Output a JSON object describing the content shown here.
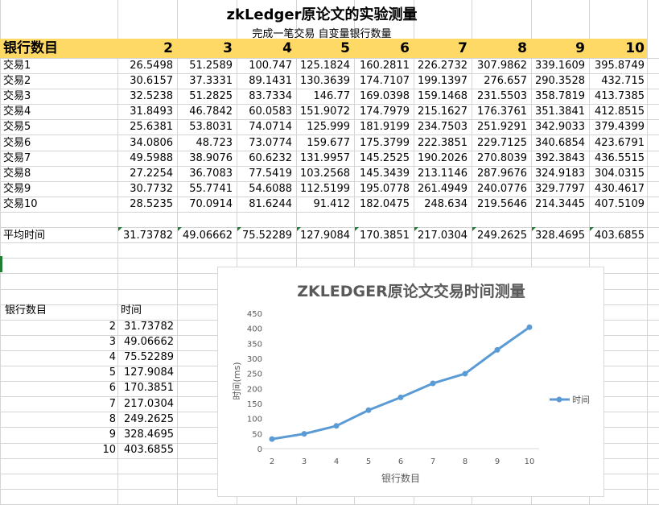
{
  "title": "zkLedger原论文的实验测量",
  "subtitle": "完成一笔交易 自变量银行数量",
  "header_label": "银行数目",
  "bank_counts": [
    "2",
    "3",
    "4",
    "5",
    "6",
    "7",
    "8",
    "9",
    "10"
  ],
  "rows": [
    {
      "label": "交易1",
      "values": [
        "26.5498",
        "51.2589",
        "100.747",
        "125.1824",
        "160.2811",
        "226.2732",
        "307.9862",
        "339.1609",
        "395.8749"
      ]
    },
    {
      "label": "交易2",
      "values": [
        "30.6157",
        "37.3331",
        "89.1431",
        "130.3639",
        "174.7107",
        "199.1397",
        "276.657",
        "290.3528",
        "432.715"
      ]
    },
    {
      "label": "交易3",
      "values": [
        "32.5238",
        "51.2825",
        "83.7334",
        "146.77",
        "169.0398",
        "159.1468",
        "231.5503",
        "358.7819",
        "413.7385"
      ]
    },
    {
      "label": "交易4",
      "values": [
        "31.8493",
        "46.7842",
        "60.0583",
        "151.9072",
        "174.7979",
        "215.1627",
        "176.3761",
        "351.3841",
        "412.8515"
      ]
    },
    {
      "label": "交易5",
      "values": [
        "25.6381",
        "53.8031",
        "74.0714",
        "125.999",
        "181.9199",
        "234.7503",
        "251.9291",
        "342.9033",
        "379.4399"
      ]
    },
    {
      "label": "交易6",
      "values": [
        "34.0806",
        "48.723",
        "73.0774",
        "159.677",
        "175.3799",
        "222.3851",
        "229.7125",
        "340.6854",
        "423.6791"
      ]
    },
    {
      "label": "交易7",
      "values": [
        "49.5988",
        "38.9076",
        "60.6232",
        "131.9957",
        "145.2525",
        "190.2026",
        "270.8039",
        "392.3843",
        "436.5515"
      ]
    },
    {
      "label": "交易8",
      "values": [
        "27.2254",
        "36.7083",
        "77.5419",
        "103.2568",
        "145.3439",
        "213.1146",
        "287.9676",
        "324.9183",
        "304.0315"
      ]
    },
    {
      "label": "交易9",
      "values": [
        "30.7732",
        "55.7741",
        "54.6088",
        "112.5199",
        "195.0778",
        "261.4949",
        "240.0776",
        "329.7797",
        "430.4617"
      ]
    },
    {
      "label": "交易10",
      "values": [
        "28.5235",
        "70.0914",
        "81.6244",
        "91.412",
        "182.0475",
        "248.634",
        "219.5646",
        "214.3445",
        "407.5109"
      ]
    }
  ],
  "average": {
    "label": "平均时间",
    "values": [
      "31.73782",
      "49.06662",
      "75.52289",
      "127.9084",
      "170.3851",
      "217.0304",
      "249.2625",
      "328.4695",
      "403.6855"
    ]
  },
  "summary": {
    "col1_header": "银行数目",
    "col2_header": "时间",
    "rows": [
      {
        "n": "2",
        "t": "31.73782"
      },
      {
        "n": "3",
        "t": "49.06662"
      },
      {
        "n": "4",
        "t": "75.52289"
      },
      {
        "n": "5",
        "t": "127.9084"
      },
      {
        "n": "6",
        "t": "170.3851"
      },
      {
        "n": "7",
        "t": "217.0304"
      },
      {
        "n": "8",
        "t": "249.2625"
      },
      {
        "n": "9",
        "t": "328.4695"
      },
      {
        "n": "10",
        "t": "403.6855"
      }
    ]
  },
  "chart_data": {
    "type": "line",
    "title": "ZKLEDGER原论文交易时间测量",
    "xlabel": "银行数目",
    "ylabel": "时间(ms)",
    "x": [
      2,
      3,
      4,
      5,
      6,
      7,
      8,
      9,
      10
    ],
    "ylim": [
      0,
      450
    ],
    "yticks": [
      0,
      50,
      100,
      150,
      200,
      250,
      300,
      350,
      400,
      450
    ],
    "series": [
      {
        "name": "时间",
        "values": [
          31.73782,
          49.06662,
          75.52289,
          127.9084,
          170.3851,
          217.0304,
          249.2625,
          328.4695,
          403.6855
        ]
      }
    ],
    "legend": "right",
    "grid": false,
    "color": "#5b9bd5"
  }
}
